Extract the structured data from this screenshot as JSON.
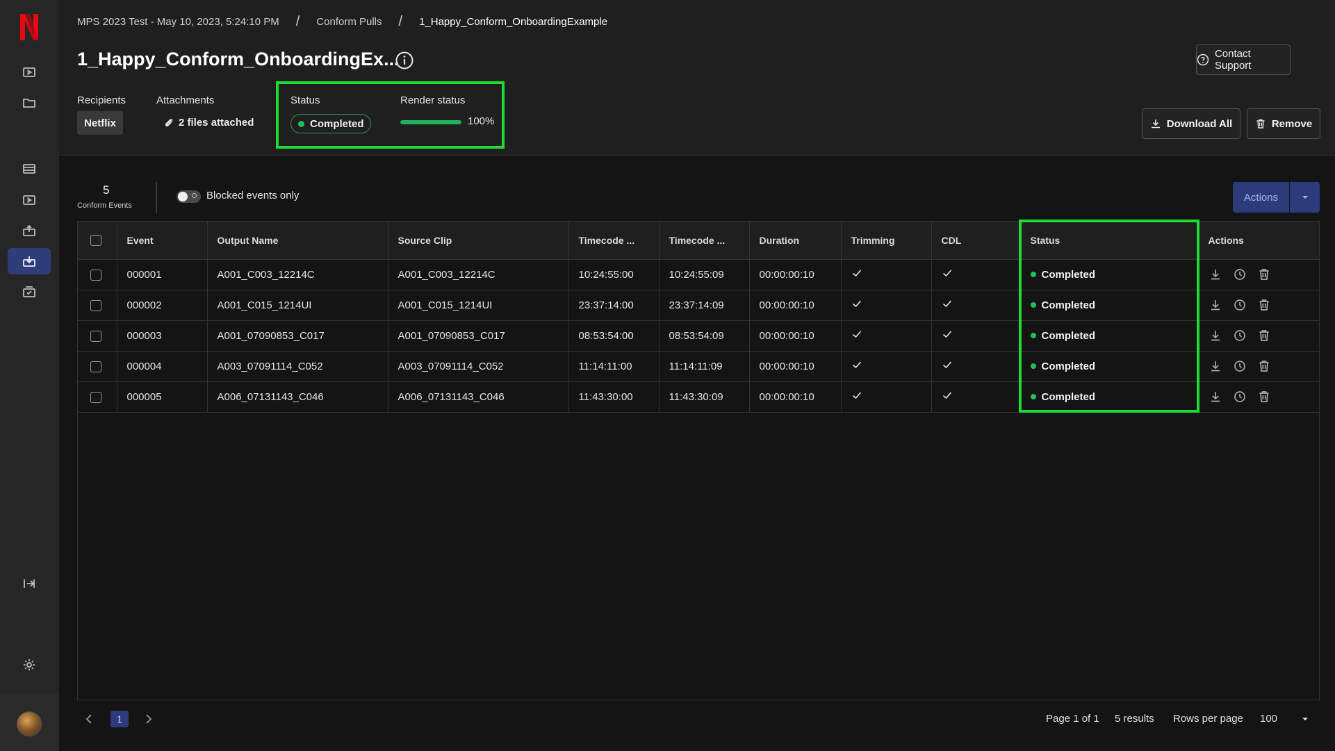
{
  "breadcrumb": {
    "items": [
      "MPS 2023 Test - May 10, 2023, 5:24:10 PM",
      "Conform Pulls",
      "1_Happy_Conform_OnboardingExample"
    ],
    "separator": "/"
  },
  "page": {
    "title": "1_Happy_Conform_OnboardingEx...",
    "contact_support": "Contact Support",
    "download_all": "Download All",
    "remove": "Remove"
  },
  "meta": {
    "recipients_label": "Recipients",
    "recipient": "Netflix",
    "attachments_label": "Attachments",
    "attachments_value": "2 files attached",
    "status_label": "Status",
    "status_value": "Completed",
    "render_label": "Render status",
    "render_progress": 100,
    "render_text": "100%"
  },
  "toolbar": {
    "event_count": "5",
    "event_count_label": "Conform Events",
    "toggle_label": "Blocked events only",
    "toggle_on": false,
    "actions_label": "Actions"
  },
  "table": {
    "columns": [
      "Event",
      "Output Name",
      "Source Clip",
      "Timecode ...",
      "Timecode ...",
      "Duration",
      "Trimming",
      "CDL",
      "Status",
      "Actions"
    ],
    "rows": [
      {
        "event": "000001",
        "output": "A001_C003_12214C",
        "source": "A001_C003_12214C",
        "tc_in": "10:24:55:00",
        "tc_out": "10:24:55:09",
        "duration": "00:00:00:10",
        "status": "Completed"
      },
      {
        "event": "000002",
        "output": "A001_C015_1214UI",
        "source": "A001_C015_1214UI",
        "tc_in": "23:37:14:00",
        "tc_out": "23:37:14:09",
        "duration": "00:00:00:10",
        "status": "Completed"
      },
      {
        "event": "000003",
        "output": "A001_07090853_C017",
        "source": "A001_07090853_C017",
        "tc_in": "08:53:54:00",
        "tc_out": "08:53:54:09",
        "duration": "00:00:00:10",
        "status": "Completed"
      },
      {
        "event": "000004",
        "output": "A003_07091114_C052",
        "source": "A003_07091114_C052",
        "tc_in": "11:14:11:00",
        "tc_out": "11:14:11:09",
        "duration": "00:00:00:10",
        "status": "Completed"
      },
      {
        "event": "000005",
        "output": "A006_07131143_C046",
        "source": "A006_07131143_C046",
        "tc_in": "11:43:30:00",
        "tc_out": "11:43:30:09",
        "duration": "00:00:00:10",
        "status": "Completed"
      }
    ]
  },
  "pagination": {
    "current_page": "1",
    "page_of": "Page 1 of 1",
    "results": "5 results",
    "rows_per_page_label": "Rows per page",
    "rows_per_page": "100"
  },
  "colors": {
    "accent": "#2d3a7c",
    "success": "#20c05c",
    "highlight": "#1cdc33",
    "brand": "#e50914"
  }
}
